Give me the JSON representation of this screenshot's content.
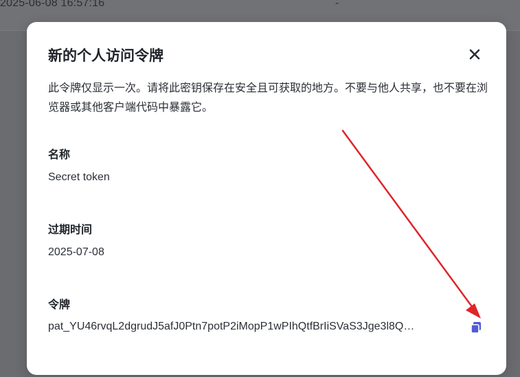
{
  "background": {
    "timestamp": "2025-06-08 16:57:16",
    "dash": "-"
  },
  "modal": {
    "title": "新的个人访问令牌",
    "description": "此令牌仅显示一次。请将此密钥保存在安全且可获取的地方。不要与他人共享，也不要在浏览器或其他客户端代码中暴露它。",
    "fields": {
      "name_label": "名称",
      "name_value": "Secret token",
      "expiry_label": "过期时间",
      "expiry_value": "2025-07-08",
      "token_label": "令牌",
      "token_value": "pat_YU46rvqL2dgrudJ5afJ0Ptn7potP2iMopP1wPIhQtfBrIiSVaS3Jge3l8Q…"
    },
    "icons": {
      "close": "close-icon",
      "copy": "copy-icon"
    }
  },
  "colors": {
    "accent": "#4f5bd5",
    "annotation_arrow": "#e0242b",
    "overlay": "#6b6c70"
  }
}
